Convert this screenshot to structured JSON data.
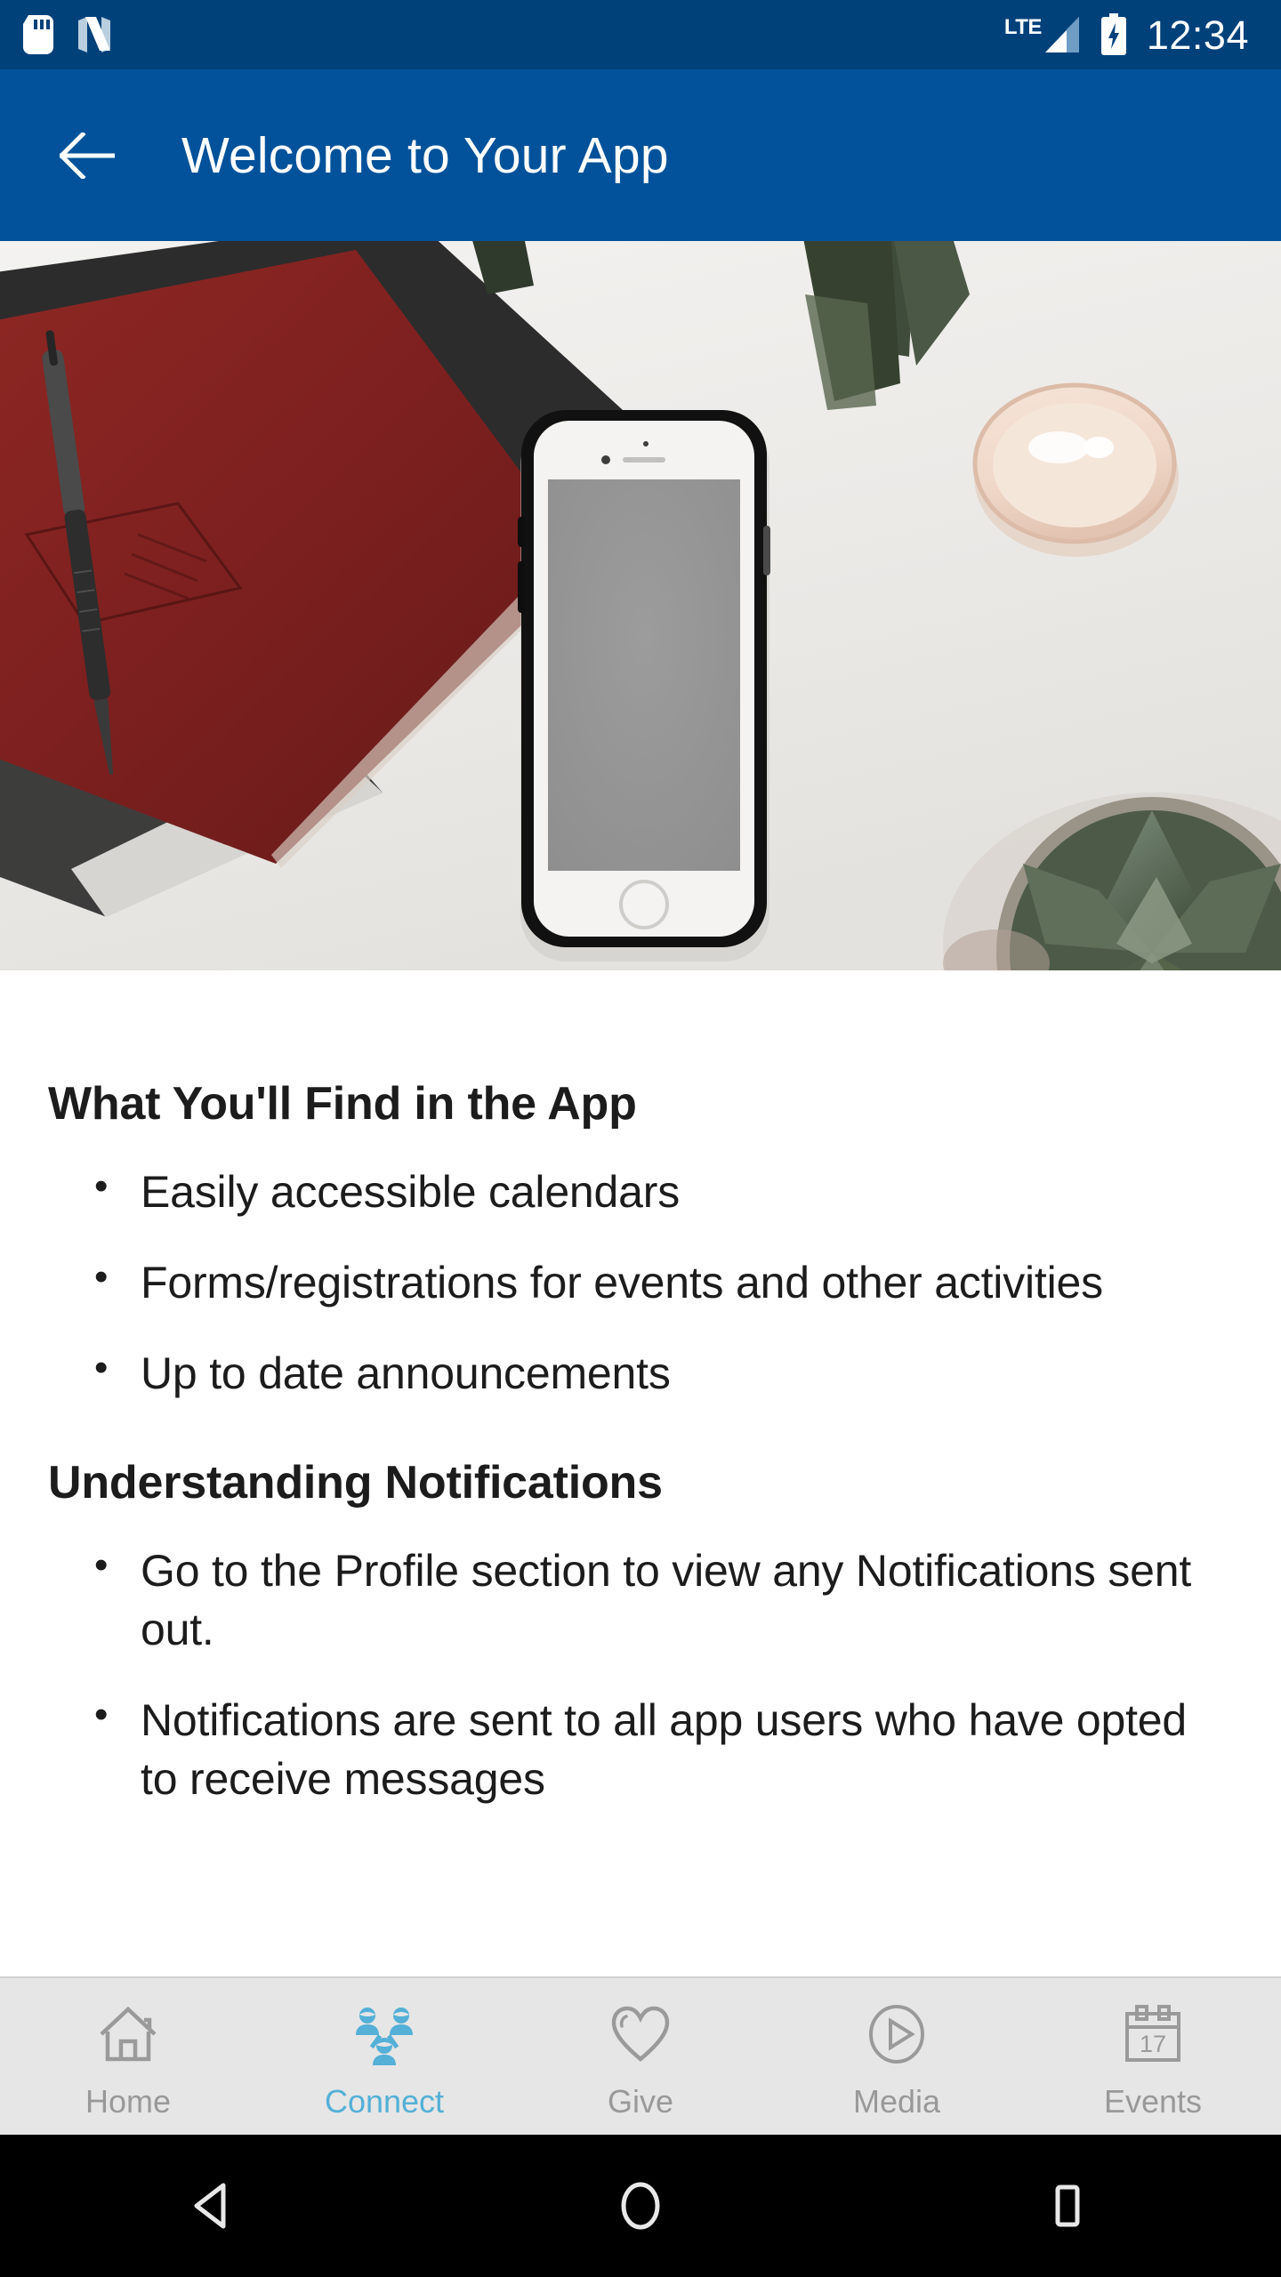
{
  "status_bar": {
    "icons": [
      "sd-card-icon",
      "android-nougat-icon"
    ],
    "network_type": "LTE",
    "signal_icon": "signal-bars-icon",
    "battery_icon": "battery-charging-icon",
    "time": "12:34",
    "background_color": "#00417A"
  },
  "app_bar": {
    "back_icon": "back-arrow-icon",
    "title": "Welcome to Your App",
    "background_color": "#01529A"
  },
  "hero": {
    "alt": "Flat lay photo of a red notebook with a pen, a white smartphone, a glass candle and succulent plants on a white desk"
  },
  "content": {
    "sections": [
      {
        "heading": "What You'll Find in the App",
        "bullets": [
          "Easily accessible calendars",
          "Forms/registrations for events and other activities",
          "Up to date announcements"
        ]
      },
      {
        "heading": "Understanding Notifications",
        "bullets": [
          "Go to the Profile section to view any Notifications sent out.",
          "Notifications are sent to all app users who have opted to receive messages"
        ]
      }
    ]
  },
  "tab_bar": {
    "active_color": "#54B0D7",
    "inactive_color": "#999999",
    "background_color": "#E6E6E6",
    "tabs": [
      {
        "label": "Home",
        "icon": "house-icon",
        "active": false
      },
      {
        "label": "Connect",
        "icon": "people-group-icon",
        "active": true
      },
      {
        "label": "Give",
        "icon": "heart-icon",
        "active": false
      },
      {
        "label": "Media",
        "icon": "play-circle-icon",
        "active": false
      },
      {
        "label": "Events",
        "icon": "calendar-icon",
        "active": false
      }
    ],
    "calendar_day": "17"
  },
  "nav_bar": {
    "back": "triangle-back-icon",
    "home": "circle-home-icon",
    "recents": "square-recents-icon"
  }
}
